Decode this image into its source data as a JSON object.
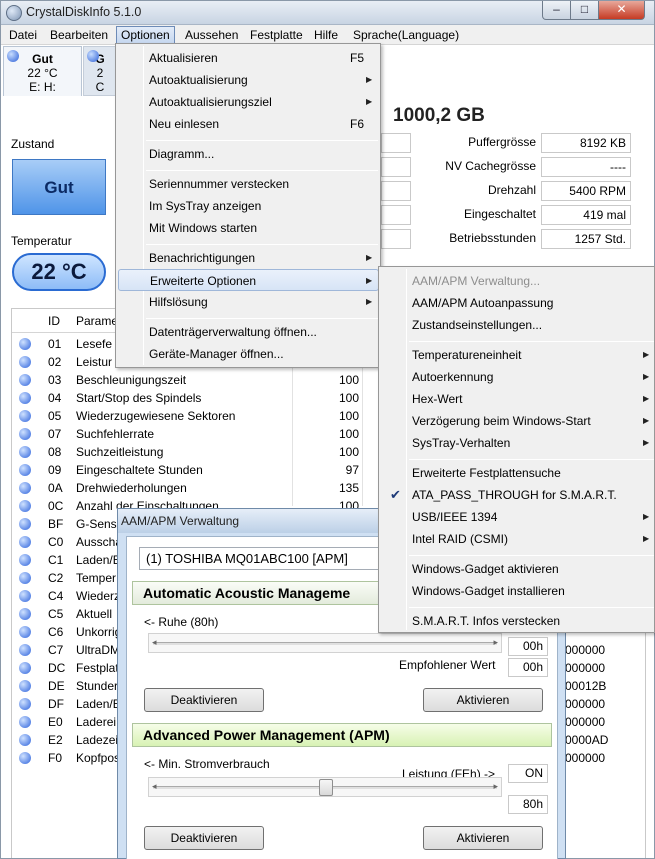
{
  "window": {
    "title": "CrystalDiskInfo 5.1.0",
    "min_glyph": "–",
    "max_glyph": "□",
    "close_glyph": "✕"
  },
  "menubar": [
    "Datei",
    "Bearbeiten",
    "Optionen",
    "Aussehen",
    "Festplatte",
    "Hilfe",
    "Sprache(Language)"
  ],
  "drives": [
    {
      "status": "Gut",
      "temp": "22 °C",
      "letters": "E: H:"
    },
    {
      "status": "G",
      "temp": "2",
      "letters": "C"
    }
  ],
  "capacity": "1000,2 GB",
  "info": [
    {
      "label": "Puffergrösse",
      "value": "8192 KB"
    },
    {
      "label": "NV Cachegrösse",
      "value": "----"
    },
    {
      "label": "Drehzahl",
      "value": "5400 RPM"
    },
    {
      "label": "Eingeschaltet",
      "value": "419 mal"
    },
    {
      "label": "Betriebsstunden",
      "value": "1257 Std."
    }
  ],
  "status": {
    "label": "Zustand",
    "value": "Gut"
  },
  "temperature": {
    "label": "Temperatur",
    "value": "22 °C"
  },
  "smart": {
    "headers": {
      "id": "ID",
      "attr": "Parame"
    },
    "rows": [
      {
        "id": "01",
        "attr": "Lesefe",
        "cur": "",
        "raw": ""
      },
      {
        "id": "02",
        "attr": "Leistur",
        "cur": "",
        "raw": ""
      },
      {
        "id": "03",
        "attr": "Beschleunigungszeit",
        "cur": "100",
        "raw": ""
      },
      {
        "id": "04",
        "attr": "Start/Stop des Spindels",
        "cur": "100",
        "raw": ""
      },
      {
        "id": "05",
        "attr": "Wiederzugewiesene Sektoren",
        "cur": "100",
        "raw": ""
      },
      {
        "id": "07",
        "attr": "Suchfehlerrate",
        "cur": "100",
        "raw": ""
      },
      {
        "id": "08",
        "attr": "Suchzeitleistung",
        "cur": "100",
        "raw": ""
      },
      {
        "id": "09",
        "attr": "Eingeschaltete Stunden",
        "cur": "97",
        "raw": ""
      },
      {
        "id": "0A",
        "attr": "Drehwiederholungen",
        "cur": "135",
        "raw": ""
      },
      {
        "id": "0C",
        "attr": "Anzahl der Einschaltungen",
        "cur": "100",
        "raw": ""
      },
      {
        "id": "BF",
        "attr": "G-Sense",
        "cur": "",
        "raw": ""
      },
      {
        "id": "C0",
        "attr": "Ausschal",
        "cur": "",
        "raw": ""
      },
      {
        "id": "C1",
        "attr": "Laden/E",
        "cur": "",
        "raw": ""
      },
      {
        "id": "C2",
        "attr": "Temper",
        "cur": "",
        "raw": ""
      },
      {
        "id": "C4",
        "attr": "Wiederz",
        "cur": "",
        "raw": ""
      },
      {
        "id": "C5",
        "attr": "Aktuell",
        "cur": "",
        "raw": ""
      },
      {
        "id": "C6",
        "attr": "Unkorrig",
        "cur": "",
        "raw": ""
      },
      {
        "id": "C7",
        "attr": "UltraDM",
        "cur": "",
        "raw": "000000"
      },
      {
        "id": "DC",
        "attr": "Festplat",
        "cur": "",
        "raw": "000000"
      },
      {
        "id": "DE",
        "attr": "Stunder",
        "cur": "",
        "raw": "00012B"
      },
      {
        "id": "DF",
        "attr": "Laden/E",
        "cur": "",
        "raw": "000000"
      },
      {
        "id": "E0",
        "attr": "Laderei",
        "cur": "",
        "raw": "000000"
      },
      {
        "id": "E2",
        "attr": "Ladezei",
        "cur": "",
        "raw": "0000AD"
      },
      {
        "id": "F0",
        "attr": "Kopfpos",
        "cur": "",
        "raw": "000000"
      }
    ]
  },
  "options_menu": {
    "items": [
      {
        "label": "Aktualisieren",
        "shortcut": "F5"
      },
      {
        "label": "Autoaktualisierung",
        "arrow": "▶"
      },
      {
        "label": "Autoaktualisierungsziel",
        "arrow": "▶"
      },
      {
        "label": "Neu einlesen",
        "shortcut": "F6"
      },
      {
        "label": "Diagramm..."
      },
      {
        "label": "Seriennummer verstecken"
      },
      {
        "label": "Im SysTray anzeigen"
      },
      {
        "label": "Mit Windows starten"
      },
      {
        "label": "Benachrichtigungen",
        "arrow": "▶"
      },
      {
        "label": "Erweiterte Optionen",
        "arrow": "▶"
      },
      {
        "label": "Hilfslösung",
        "arrow": "▶"
      },
      {
        "label": "Datenträgerverwaltung öffnen..."
      },
      {
        "label": "Geräte-Manager öffnen..."
      }
    ]
  },
  "advanced_menu": {
    "items": [
      {
        "label": "AAM/APM Verwaltung..."
      },
      {
        "label": "AAM/APM Autoanpassung"
      },
      {
        "label": "Zustandseinstellungen..."
      },
      {
        "label": "Temperatureneinheit",
        "arrow": "▶"
      },
      {
        "label": "Autoerkennung",
        "arrow": "▶"
      },
      {
        "label": "Hex-Wert",
        "arrow": "▶"
      },
      {
        "label": "Verzögerung beim Windows-Start",
        "arrow": "▶"
      },
      {
        "label": "SysTray-Verhalten",
        "arrow": "▶"
      },
      {
        "label": "Erweiterte Festplattensuche"
      },
      {
        "label": "ATA_PASS_THROUGH for S.M.A.R.T.",
        "check": "✔"
      },
      {
        "label": "USB/IEEE 1394",
        "arrow": "▶"
      },
      {
        "label": "Intel RAID (CSMI)",
        "arrow": "▶"
      },
      {
        "label": "Windows-Gadget aktivieren"
      },
      {
        "label": "Windows-Gadget installieren"
      },
      {
        "label": "S.M.A.R.T. Infos verstecken"
      }
    ]
  },
  "aam_dialog": {
    "title": "AAM/APM Verwaltung",
    "drive": "(1) TOSHIBA MQ01ABC100 [APM]",
    "aam": {
      "header": "Automatic Acoustic Manageme",
      "left_label": "<- Ruhe (80h)",
      "value": "00h",
      "recommended_label": "Empfohlener Wert",
      "recommended_value": "00h",
      "disable": "Deaktivieren",
      "enable": "Aktivieren"
    },
    "apm": {
      "header": "Advanced Power Management (APM)",
      "left_label": "<- Min. Stromverbrauch",
      "right_label": "Leistung (FEh) ->",
      "state": "ON",
      "value": "80h",
      "disable": "Deaktivieren",
      "enable": "Aktivieren"
    }
  }
}
